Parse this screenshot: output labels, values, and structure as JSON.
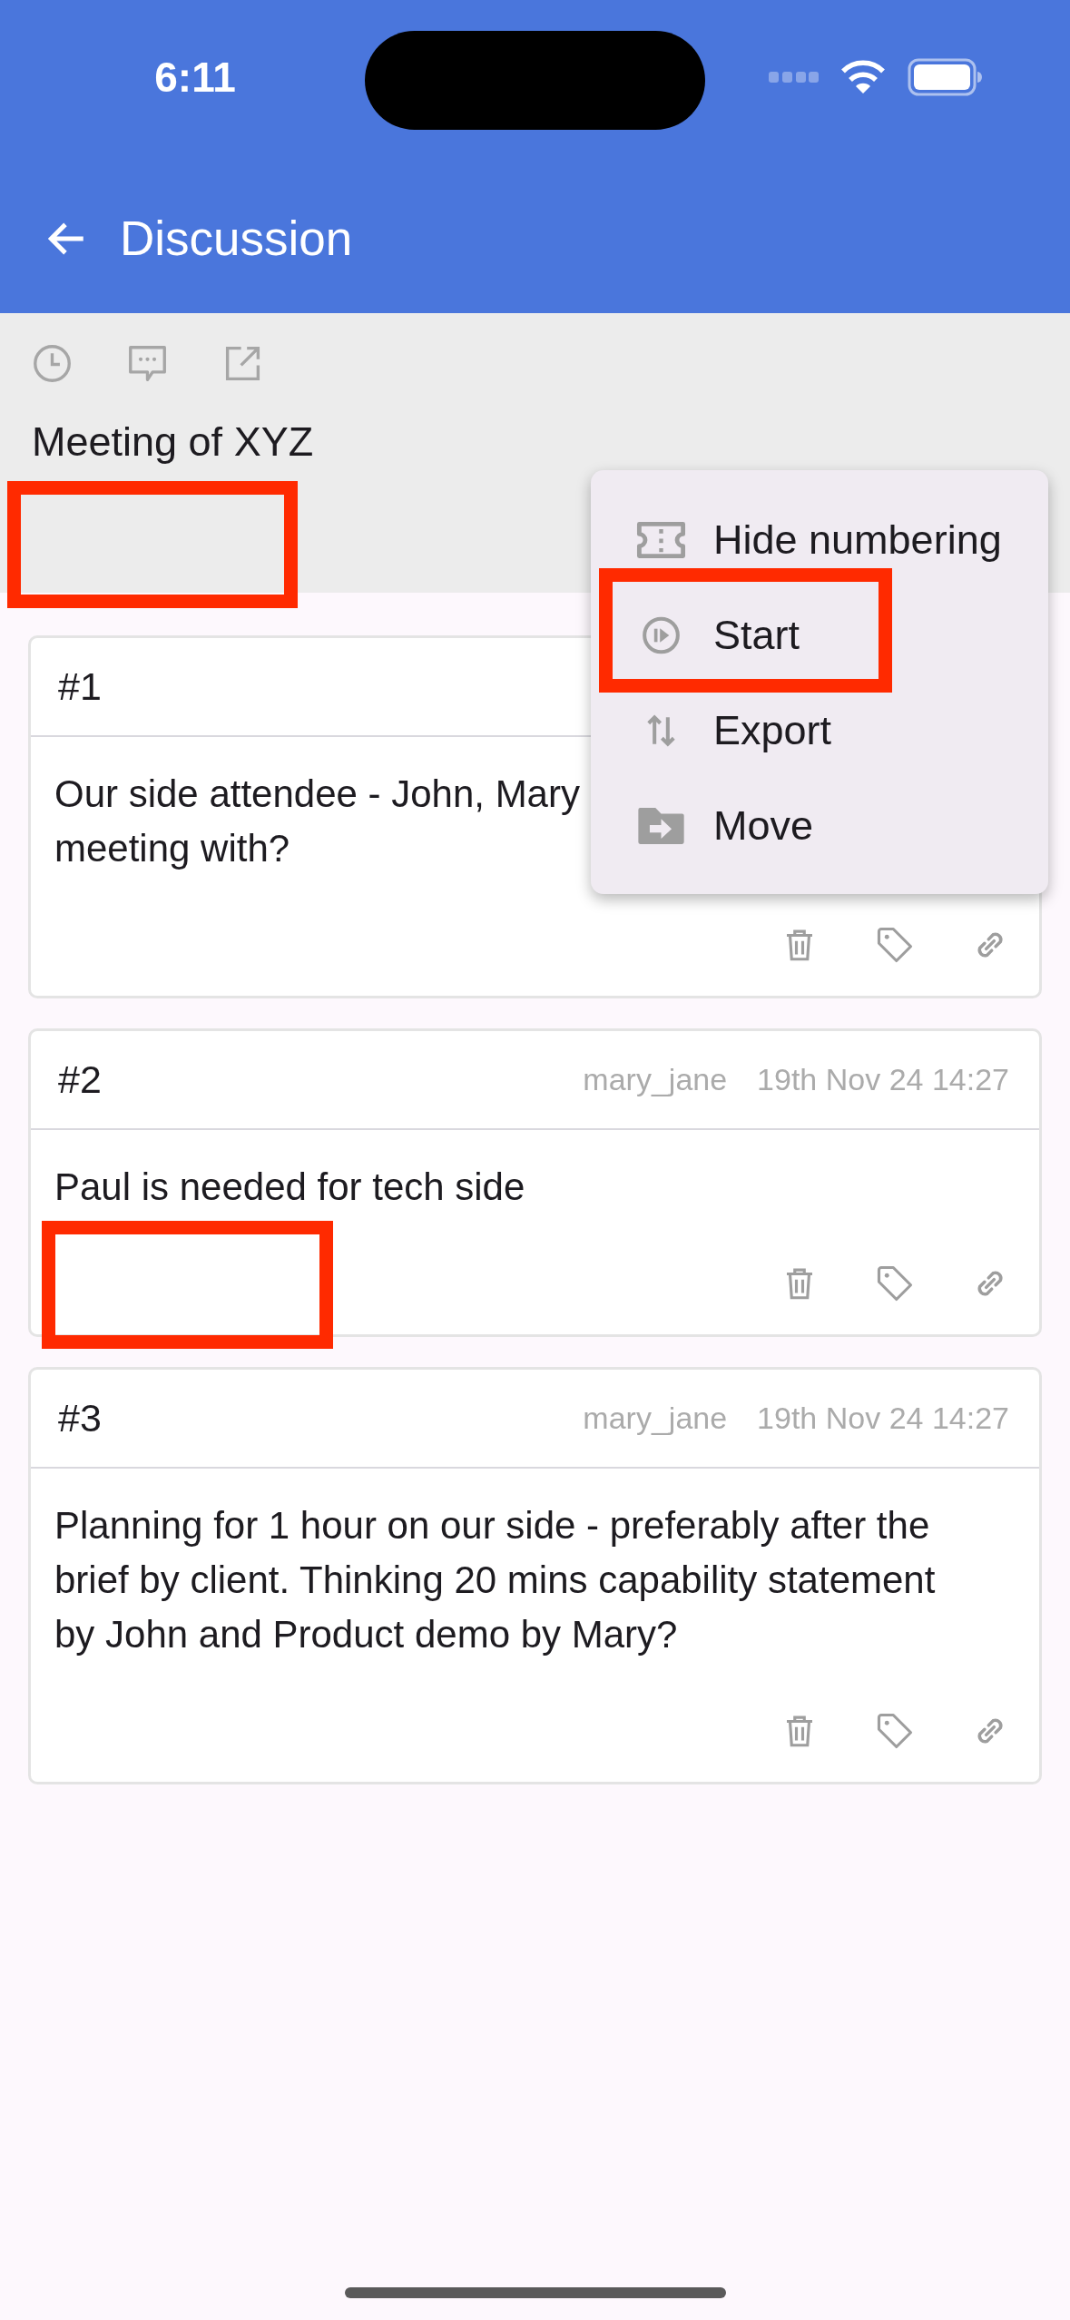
{
  "status_bar": {
    "time": "6:11"
  },
  "app_bar": {
    "title": "Discussion"
  },
  "topic": {
    "title": "Meeting of XYZ",
    "highlighted_area": true
  },
  "context_menu": {
    "items": [
      {
        "label": "Hide numbering",
        "kind": "numbering",
        "highlighted": false
      },
      {
        "label": "Start",
        "kind": "start",
        "highlighted": true
      },
      {
        "label": "Export",
        "kind": "export",
        "highlighted": false
      },
      {
        "label": "Move",
        "kind": "move",
        "highlighted": false
      }
    ]
  },
  "posts": [
    {
      "number": "#1",
      "lines": [
        "Our side attendee - John, Mary",
        "meeting with?"
      ],
      "highlighted_area": false
    },
    {
      "number": "#2",
      "author": "mary_jane",
      "timestamp": "19th Nov 24 14:27",
      "lines": [
        "Paul is needed for tech side"
      ],
      "highlighted_area": true
    },
    {
      "number": "#3",
      "author": "mary_jane",
      "timestamp": "19th Nov 24 14:27",
      "lines": [
        "Planning for 1 hour on our side - preferably after the",
        "brief by client. Thinking 20 mins capability statement",
        "by John and Product demo by Mary?"
      ],
      "highlighted_area": false
    }
  ]
}
